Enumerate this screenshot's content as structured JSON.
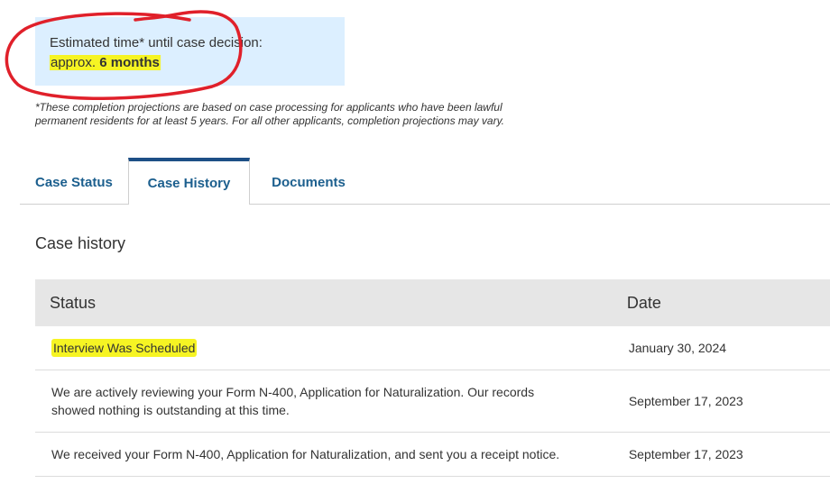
{
  "estimate": {
    "label": "Estimated time* until case decision:",
    "prefix": "approx.",
    "value": "6 months"
  },
  "disclaimer": {
    "line1": "*These completion projections are based on case processing for applicants who have been lawful",
    "line2": "permanent residents for at least 5 years. For all other applicants, completion projections may vary."
  },
  "tabs": [
    {
      "label": "Case Status",
      "active": false
    },
    {
      "label": "Case History",
      "active": true
    },
    {
      "label": "Documents",
      "active": false
    }
  ],
  "section": {
    "title": "Case history"
  },
  "table": {
    "headers": [
      "Status",
      "Date"
    ],
    "rows": [
      {
        "status": "Interview Was Scheduled",
        "date": "January 30, 2024"
      },
      {
        "status": "We are actively reviewing your Form N-400, Application for Naturalization. Our records showed nothing is outstanding at this time.",
        "date": "September 17, 2023"
      },
      {
        "status": "We received your Form N-400, Application for Naturalization, and sent you a receipt notice.",
        "date": "September 17, 2023"
      }
    ]
  },
  "colors": {
    "highlight": "#f6f423",
    "annotation": "#e0202a",
    "tab_active": "#1d4f86",
    "tab_text": "#1c5f8e",
    "estimate_bg": "#dcefff"
  }
}
